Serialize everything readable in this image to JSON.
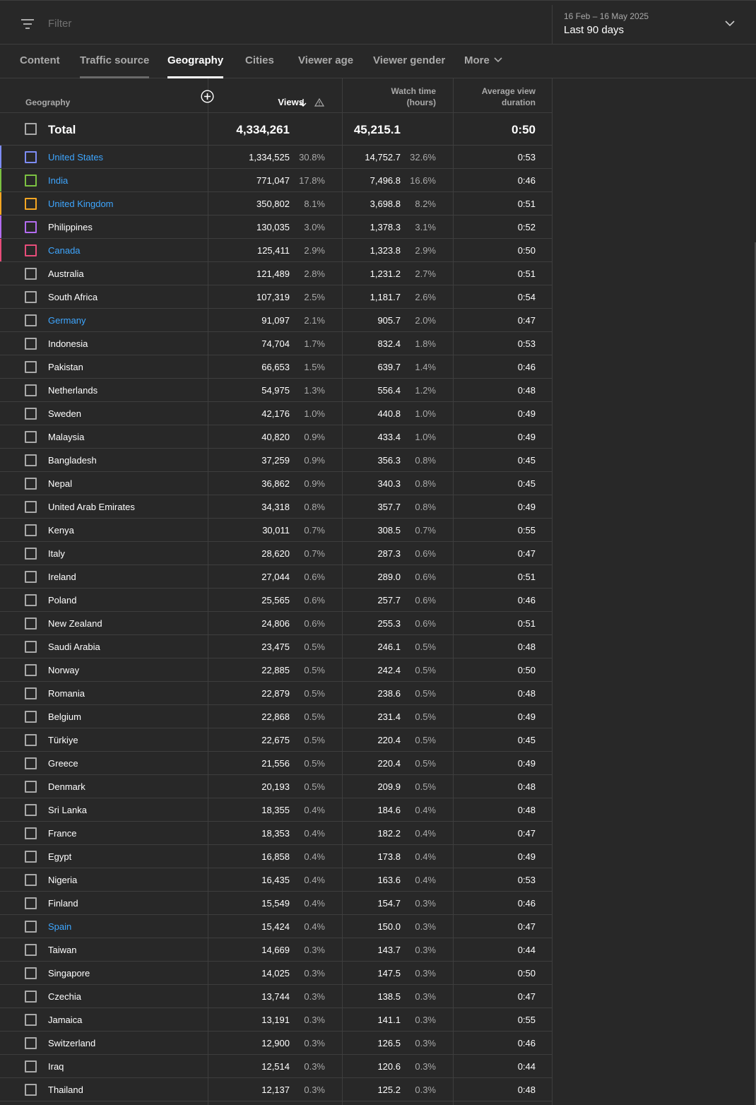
{
  "filter": {
    "placeholder": "Filter"
  },
  "date": {
    "range": "16 Feb – 16 May 2025",
    "label": "Last 90 days"
  },
  "tabs": [
    "Content",
    "Traffic source",
    "Geography",
    "Cities",
    "Viewer age",
    "Viewer gender",
    "More"
  ],
  "active_tab": "Geography",
  "columns": {
    "geography": "Geography",
    "views": "Views",
    "watch_time_1": "Watch time",
    "watch_time_2": "(hours)",
    "avd_1": "Average view",
    "avd_2": "duration"
  },
  "total": {
    "label": "Total",
    "views": "4,334,261",
    "watch": "45,215.1",
    "avd": "0:50"
  },
  "colors": {
    "accent_link": "#3ea6ff",
    "series": [
      "#7d8cf5",
      "#7cc242",
      "#f5a623",
      "#b36cf0",
      "#e84d7a"
    ]
  },
  "rows": [
    {
      "name": "United States",
      "views": "1,334,525",
      "vpct": "30.8%",
      "watch": "14,752.7",
      "wpct": "32.6%",
      "avd": "0:53",
      "link": true,
      "color": "#7d8cf5"
    },
    {
      "name": "India",
      "views": "771,047",
      "vpct": "17.8%",
      "watch": "7,496.8",
      "wpct": "16.6%",
      "avd": "0:46",
      "link": true,
      "color": "#7cc242"
    },
    {
      "name": "United Kingdom",
      "views": "350,802",
      "vpct": "8.1%",
      "watch": "3,698.8",
      "wpct": "8.2%",
      "avd": "0:51",
      "link": true,
      "color": "#f5a623"
    },
    {
      "name": "Philippines",
      "views": "130,035",
      "vpct": "3.0%",
      "watch": "1,378.3",
      "wpct": "3.1%",
      "avd": "0:52",
      "link": false,
      "color": "#b36cf0"
    },
    {
      "name": "Canada",
      "views": "125,411",
      "vpct": "2.9%",
      "watch": "1,323.8",
      "wpct": "2.9%",
      "avd": "0:50",
      "link": true,
      "color": "#e84d7a"
    },
    {
      "name": "Australia",
      "views": "121,489",
      "vpct": "2.8%",
      "watch": "1,231.2",
      "wpct": "2.7%",
      "avd": "0:51"
    },
    {
      "name": "South Africa",
      "views": "107,319",
      "vpct": "2.5%",
      "watch": "1,181.7",
      "wpct": "2.6%",
      "avd": "0:54"
    },
    {
      "name": "Germany",
      "views": "91,097",
      "vpct": "2.1%",
      "watch": "905.7",
      "wpct": "2.0%",
      "avd": "0:47",
      "link": true
    },
    {
      "name": "Indonesia",
      "views": "74,704",
      "vpct": "1.7%",
      "watch": "832.4",
      "wpct": "1.8%",
      "avd": "0:53"
    },
    {
      "name": "Pakistan",
      "views": "66,653",
      "vpct": "1.5%",
      "watch": "639.7",
      "wpct": "1.4%",
      "avd": "0:46"
    },
    {
      "name": "Netherlands",
      "views": "54,975",
      "vpct": "1.3%",
      "watch": "556.4",
      "wpct": "1.2%",
      "avd": "0:48"
    },
    {
      "name": "Sweden",
      "views": "42,176",
      "vpct": "1.0%",
      "watch": "440.8",
      "wpct": "1.0%",
      "avd": "0:49"
    },
    {
      "name": "Malaysia",
      "views": "40,820",
      "vpct": "0.9%",
      "watch": "433.4",
      "wpct": "1.0%",
      "avd": "0:49"
    },
    {
      "name": "Bangladesh",
      "views": "37,259",
      "vpct": "0.9%",
      "watch": "356.3",
      "wpct": "0.8%",
      "avd": "0:45"
    },
    {
      "name": "Nepal",
      "views": "36,862",
      "vpct": "0.9%",
      "watch": "340.3",
      "wpct": "0.8%",
      "avd": "0:45"
    },
    {
      "name": "United Arab Emirates",
      "views": "34,318",
      "vpct": "0.8%",
      "watch": "357.7",
      "wpct": "0.8%",
      "avd": "0:49"
    },
    {
      "name": "Kenya",
      "views": "30,011",
      "vpct": "0.7%",
      "watch": "308.5",
      "wpct": "0.7%",
      "avd": "0:55"
    },
    {
      "name": "Italy",
      "views": "28,620",
      "vpct": "0.7%",
      "watch": "287.3",
      "wpct": "0.6%",
      "avd": "0:47"
    },
    {
      "name": "Ireland",
      "views": "27,044",
      "vpct": "0.6%",
      "watch": "289.0",
      "wpct": "0.6%",
      "avd": "0:51"
    },
    {
      "name": "Poland",
      "views": "25,565",
      "vpct": "0.6%",
      "watch": "257.7",
      "wpct": "0.6%",
      "avd": "0:46"
    },
    {
      "name": "New Zealand",
      "views": "24,806",
      "vpct": "0.6%",
      "watch": "255.3",
      "wpct": "0.6%",
      "avd": "0:51"
    },
    {
      "name": "Saudi Arabia",
      "views": "23,475",
      "vpct": "0.5%",
      "watch": "246.1",
      "wpct": "0.5%",
      "avd": "0:48"
    },
    {
      "name": "Norway",
      "views": "22,885",
      "vpct": "0.5%",
      "watch": "242.4",
      "wpct": "0.5%",
      "avd": "0:50"
    },
    {
      "name": "Romania",
      "views": "22,879",
      "vpct": "0.5%",
      "watch": "238.6",
      "wpct": "0.5%",
      "avd": "0:48"
    },
    {
      "name": "Belgium",
      "views": "22,868",
      "vpct": "0.5%",
      "watch": "231.4",
      "wpct": "0.5%",
      "avd": "0:49"
    },
    {
      "name": "Türkiye",
      "views": "22,675",
      "vpct": "0.5%",
      "watch": "220.4",
      "wpct": "0.5%",
      "avd": "0:45"
    },
    {
      "name": "Greece",
      "views": "21,556",
      "vpct": "0.5%",
      "watch": "220.4",
      "wpct": "0.5%",
      "avd": "0:49"
    },
    {
      "name": "Denmark",
      "views": "20,193",
      "vpct": "0.5%",
      "watch": "209.9",
      "wpct": "0.5%",
      "avd": "0:48"
    },
    {
      "name": "Sri Lanka",
      "views": "18,355",
      "vpct": "0.4%",
      "watch": "184.6",
      "wpct": "0.4%",
      "avd": "0:48"
    },
    {
      "name": "France",
      "views": "18,353",
      "vpct": "0.4%",
      "watch": "182.2",
      "wpct": "0.4%",
      "avd": "0:47"
    },
    {
      "name": "Egypt",
      "views": "16,858",
      "vpct": "0.4%",
      "watch": "173.8",
      "wpct": "0.4%",
      "avd": "0:49"
    },
    {
      "name": "Nigeria",
      "views": "16,435",
      "vpct": "0.4%",
      "watch": "163.6",
      "wpct": "0.4%",
      "avd": "0:53"
    },
    {
      "name": "Finland",
      "views": "15,549",
      "vpct": "0.4%",
      "watch": "154.7",
      "wpct": "0.3%",
      "avd": "0:46"
    },
    {
      "name": "Spain",
      "views": "15,424",
      "vpct": "0.4%",
      "watch": "150.0",
      "wpct": "0.3%",
      "avd": "0:47",
      "link": true
    },
    {
      "name": "Taiwan",
      "views": "14,669",
      "vpct": "0.3%",
      "watch": "143.7",
      "wpct": "0.3%",
      "avd": "0:44"
    },
    {
      "name": "Singapore",
      "views": "14,025",
      "vpct": "0.3%",
      "watch": "147.5",
      "wpct": "0.3%",
      "avd": "0:50"
    },
    {
      "name": "Czechia",
      "views": "13,744",
      "vpct": "0.3%",
      "watch": "138.5",
      "wpct": "0.3%",
      "avd": "0:47"
    },
    {
      "name": "Jamaica",
      "views": "13,191",
      "vpct": "0.3%",
      "watch": "141.1",
      "wpct": "0.3%",
      "avd": "0:55"
    },
    {
      "name": "Switzerland",
      "views": "12,900",
      "vpct": "0.3%",
      "watch": "126.5",
      "wpct": "0.3%",
      "avd": "0:46"
    },
    {
      "name": "Iraq",
      "views": "12,514",
      "vpct": "0.3%",
      "watch": "120.6",
      "wpct": "0.3%",
      "avd": "0:44"
    },
    {
      "name": "Thailand",
      "views": "12,137",
      "vpct": "0.3%",
      "watch": "125.2",
      "wpct": "0.3%",
      "avd": "0:48"
    }
  ]
}
